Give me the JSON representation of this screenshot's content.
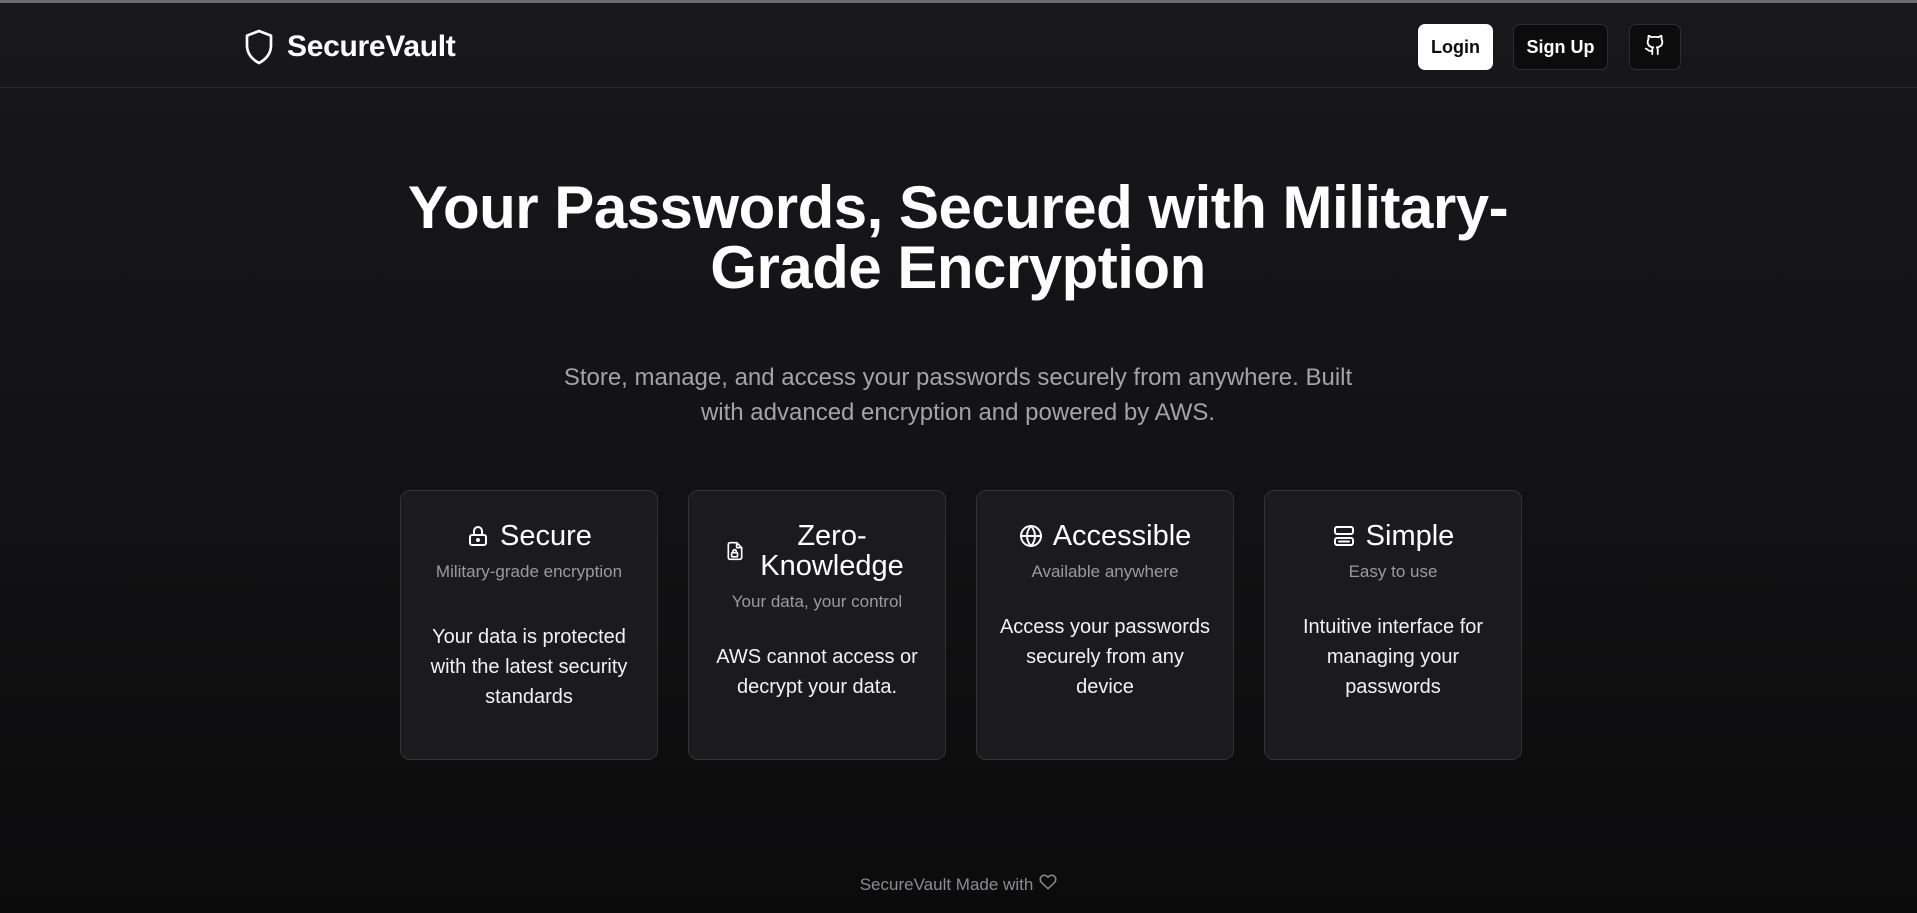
{
  "header": {
    "brand": {
      "name": "SecureVault",
      "icon": "shield-icon"
    },
    "nav": {
      "login_label": "Login",
      "signup_label": "Sign Up",
      "github_icon": "github-icon"
    }
  },
  "hero": {
    "title": "Your Passwords, Secured with Military-Grade Encryption",
    "subtitle": "Store, manage, and access your passwords securely from anywhere. Built with advanced encryption and powered by AWS."
  },
  "features": [
    {
      "icon": "lock-icon",
      "title": "Secure",
      "subtitle": "Military-grade encryption",
      "description": "Your data is protected with the latest security standards"
    },
    {
      "icon": "file-lock-icon",
      "title": "Zero-Knowledge",
      "subtitle": "Your data, your control",
      "description": "AWS cannot access or decrypt your data."
    },
    {
      "icon": "globe-icon",
      "title": "Accessible",
      "subtitle": "Available anywhere",
      "description": "Access your passwords securely from any device"
    },
    {
      "icon": "server-icon",
      "title": "Simple",
      "subtitle": "Easy to use",
      "description": "Intuitive interface for managing your passwords"
    }
  ],
  "footer": {
    "text": "SecureVault Made with",
    "icon": "heart-icon"
  },
  "colors": {
    "background": "#141416",
    "card_background": "#1b1b1d",
    "card_border": "#333336",
    "muted_text": "#a3a3a8",
    "primary_button": "#ffffff"
  }
}
